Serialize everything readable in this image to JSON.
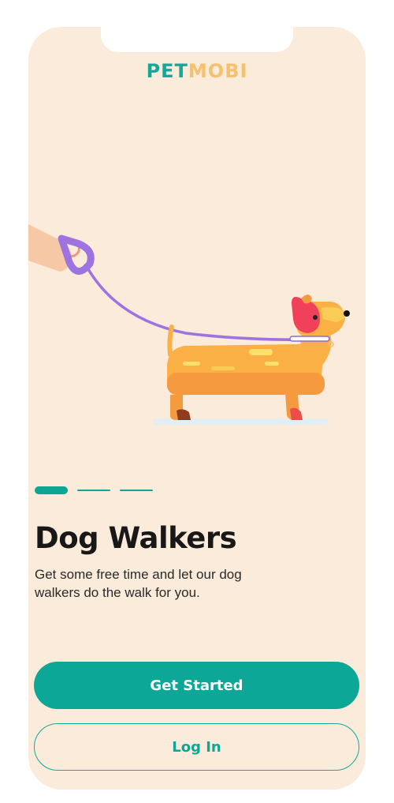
{
  "brand": {
    "part1": "PET",
    "part2": "MOBI"
  },
  "onboarding": {
    "pages_total": 3,
    "current_page": 1,
    "title": "Dog Walkers",
    "subtitle": "Get some free time and let our dog walkers do the walk for you."
  },
  "actions": {
    "primary_label": "Get Started",
    "secondary_label": "Log In"
  },
  "colors": {
    "background": "#FBEBDA",
    "accent": "#0CA797",
    "logo_secondary": "#F5C16E",
    "leash": "#9E73E0",
    "dog_body": "#FBB045"
  }
}
